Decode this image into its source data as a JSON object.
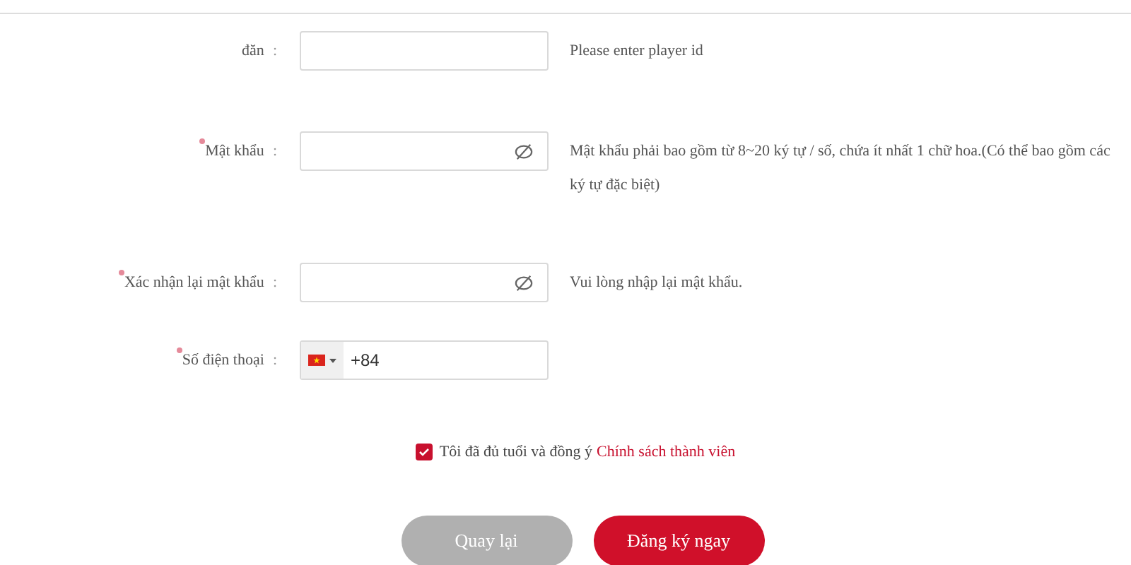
{
  "fields": [
    {
      "kind": "text",
      "label": "đăn",
      "required": false,
      "hint": "Please enter player id"
    },
    {
      "kind": "password",
      "label": "Mật khẩu",
      "required": true,
      "hint": "Mật khẩu phải bao gồm từ 8~20 ký tự / số, chứa ít nhất 1 chữ hoa.(Có thể bao gồm các ký tự đặc biệt)"
    },
    {
      "kind": "password",
      "label": "Xác nhận lại mật khẩu",
      "required": true,
      "hint": "Vui lòng nhập lại mật khẩu."
    },
    {
      "kind": "phone",
      "label": "Số điện thoại",
      "required": true,
      "value": "+84"
    }
  ],
  "colon": ":",
  "agree": {
    "checked": true,
    "text": "Tôi đã đủ tuổi và đồng ý",
    "link": "Chính sách thành viên"
  },
  "buttons": [
    {
      "label": "Quay lại",
      "kind": "secondary"
    },
    {
      "label": "Đăng ký ngay",
      "kind": "primary"
    }
  ]
}
